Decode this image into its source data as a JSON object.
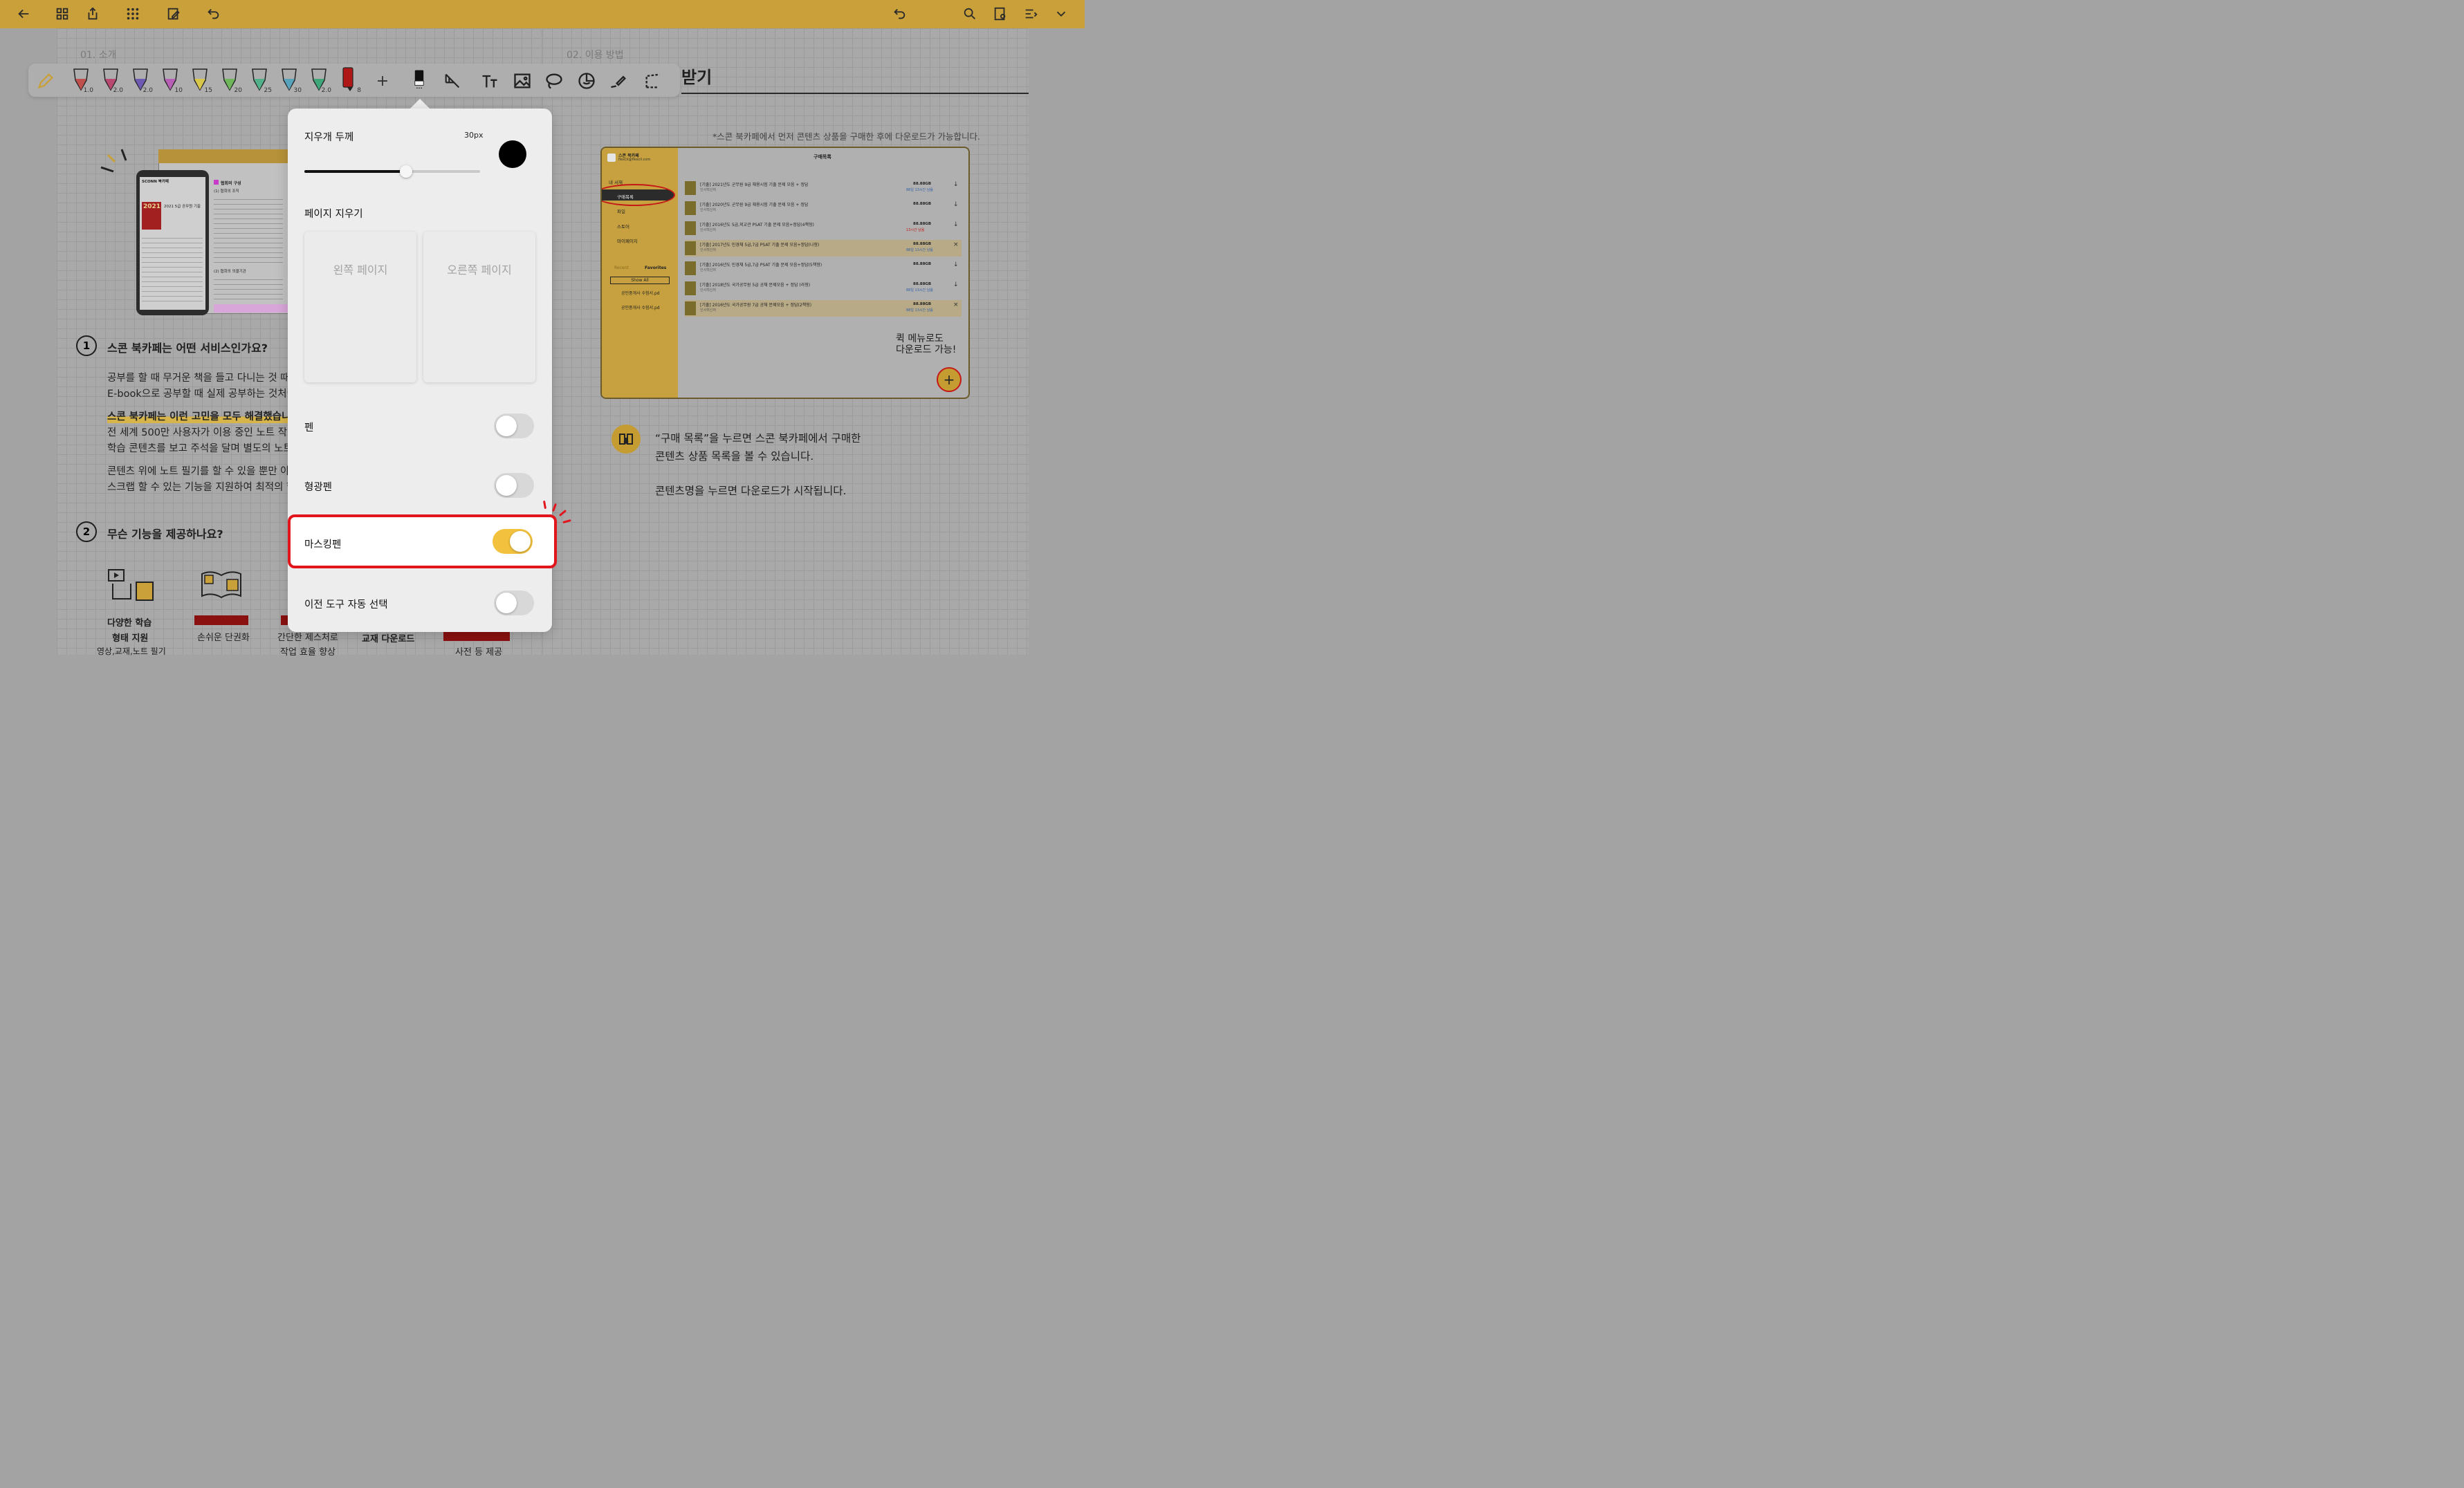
{
  "topbar": {
    "left_icons": [
      "back-arrow-icon",
      "grid-view-icon",
      "export-icon",
      "apps-dots-icon",
      "edit-page-icon",
      "undo-icon"
    ],
    "right_icons": [
      "redo-icon",
      "search-icon",
      "page-settings-icon",
      "list-menu-icon",
      "chevron-down-icon"
    ],
    "color": "#c9a03a"
  },
  "toolbar": {
    "pens": [
      {
        "size": "1.0",
        "color": "#c0504d"
      },
      {
        "size": "2.0",
        "color": "#b84870"
      },
      {
        "size": "2.0",
        "color": "#6e5ab3"
      },
      {
        "size": "10",
        "color": "#b65fb5"
      },
      {
        "size": "15",
        "color": "#d8c64a"
      },
      {
        "size": "20",
        "color": "#6fb65a"
      },
      {
        "size": "25",
        "color": "#52b08a"
      },
      {
        "size": "30",
        "color": "#58a3bc"
      },
      {
        "size": "2.0",
        "color": "#3fa67a"
      },
      {
        "size": "8",
        "color": "#b01818"
      }
    ],
    "add_label": "+",
    "tools": [
      "eraser-icon",
      "ruler-icon",
      "text-icon",
      "image-icon",
      "lasso-icon",
      "sticker-icon",
      "laser-pointer-icon",
      "crop-lasso-icon"
    ]
  },
  "left_page": {
    "section_label": "01. 소개",
    "q1_number": "1",
    "q1_title": "스콘 북카페는 어떤 서비스인가요?",
    "p1_line1": "공부를 할 때 무거운 책을 들고 다니는 것 때문",
    "p1_line2": "E-book으로 공부할 때 실제 공부하는 것처럼",
    "highlight_line": "스콘 북카페는 이런 고민을 모두 해결했습니다",
    "p2_line1": "전 세계 500만 사용자가 이용 중인 노트 작성",
    "p2_line2": "학습 콘텐츠를 보고 주석을 달며 별도의 노트를",
    "p3_line1": "콘텐츠 위에 노트 필기를 할 수 있을 뿐만 아니",
    "p3_line2": "스크랩 할 수 있는 기능을 지원하여 최적의 학",
    "q2_number": "2",
    "q2_title": "무슨 기능을 제공하나요?",
    "features": [
      {
        "line1": "다양한 학습",
        "line2": "형태 지원",
        "line3": "영상,교재,노트 필기"
      },
      {
        "line1": "손쉬운 단권화"
      },
      {
        "line1": "간단한 제스처로",
        "line2": "작업 효율 향상"
      },
      {
        "line1": "교재 다운로드"
      },
      {
        "line1": "사전 등 제공"
      }
    ],
    "preview": {
      "store_name": "SCONN 북카페",
      "year_badge": "2021",
      "book_title": "2021 5급 공무원 기출",
      "article_title": "협회의 구성",
      "article_sub1": "(1) 협회의 조직",
      "article_sub2": "(2) 협회의 의결기관"
    }
  },
  "right_page": {
    "section_label": "02. 이용 방법",
    "title": "받기",
    "note": "*스콘 북카페에서 먼저 콘텐츠 상품을 구매한 후에 다운로드가 가능합니다.",
    "app": {
      "account_name": "스콘 북카페",
      "account_email": "flexcil@flexcil.com",
      "header": "구매목록",
      "sidebar_items": [
        "내 서재",
        "구매목록",
        "파일",
        "스토어",
        "마이페이지"
      ],
      "recent_label": "Recent",
      "favorites_label": "Favorites",
      "show_all": "Show All",
      "files": [
        "공인중개사 수험서.pd",
        "공인중개사 수험서.pd"
      ],
      "rows": [
        {
          "title": "[기출] 2021년도 군무원 9급 채용시험 기출 문제 모음 + 정답",
          "publisher": "인사혁신처",
          "size": "88.88GB",
          "status": "88일 13시간 남음"
        },
        {
          "title": "[기출] 2020년도 군무원 9급 채용시험 기출 문제 모음 + 정답",
          "publisher": "인사혁신처",
          "size": "88.88GB",
          "status": ""
        },
        {
          "title": "[기출] 2016년도 5급,외교관 PSAT 기출 문제 모음+정답(4책형)",
          "publisher": "인사혁신처",
          "size": "88.88GB",
          "status": "13시간 남음"
        },
        {
          "title": "[기출] 2017년도 민경채 5급,7급 PSAT 기출 문제 모음+정답(나형)",
          "publisher": "인사혁신처",
          "size": "88.88GB",
          "status": "88일 13시간 남음"
        },
        {
          "title": "[기출] 2016년도 민경채 5급,7급 PSAT 기출 문제 모음+정답(5책형)",
          "publisher": "인사혁신처",
          "size": "88.88GB",
          "status": ""
        },
        {
          "title": "[기출] 2018년도 국가공무원 5급 공채 문제모음 + 정답 (라형)",
          "publisher": "인사혁신처",
          "size": "88.88GB",
          "status": "88일 13시간 남음"
        },
        {
          "title": "[기출] 2016년도 국가공무원 7급 공채 문제모음 + 정답(2책형)",
          "publisher": "인사혁신처",
          "size": "88.88GB",
          "status": "88일 13시간 남음"
        }
      ]
    },
    "callout": "퀵 메뉴로도\n다운로드 가능!",
    "fab_label": "+",
    "desc_line1": "“구매 목록”을 누르면 스콘 북카페에서 구매한",
    "desc_line2": "콘텐츠 상품 목록을 볼 수 있습니다.",
    "desc_line3": "콘텐츠명을 누르면 다운로드가 시작됩니다."
  },
  "eraser_popup": {
    "thickness_label": "지우개 두께",
    "thickness_value": "30px",
    "thickness_fraction": 0.58,
    "erase_page_label": "페이지 지우기",
    "left_page_button": "왼쪽 페이지",
    "right_page_button": "오른쪽 페이지",
    "options": [
      {
        "label": "펜",
        "on": false
      },
      {
        "label": "형광펜",
        "on": false
      },
      {
        "label": "마스킹펜",
        "on": true
      },
      {
        "label": "이전 도구 자동 선택",
        "on": false
      }
    ]
  }
}
